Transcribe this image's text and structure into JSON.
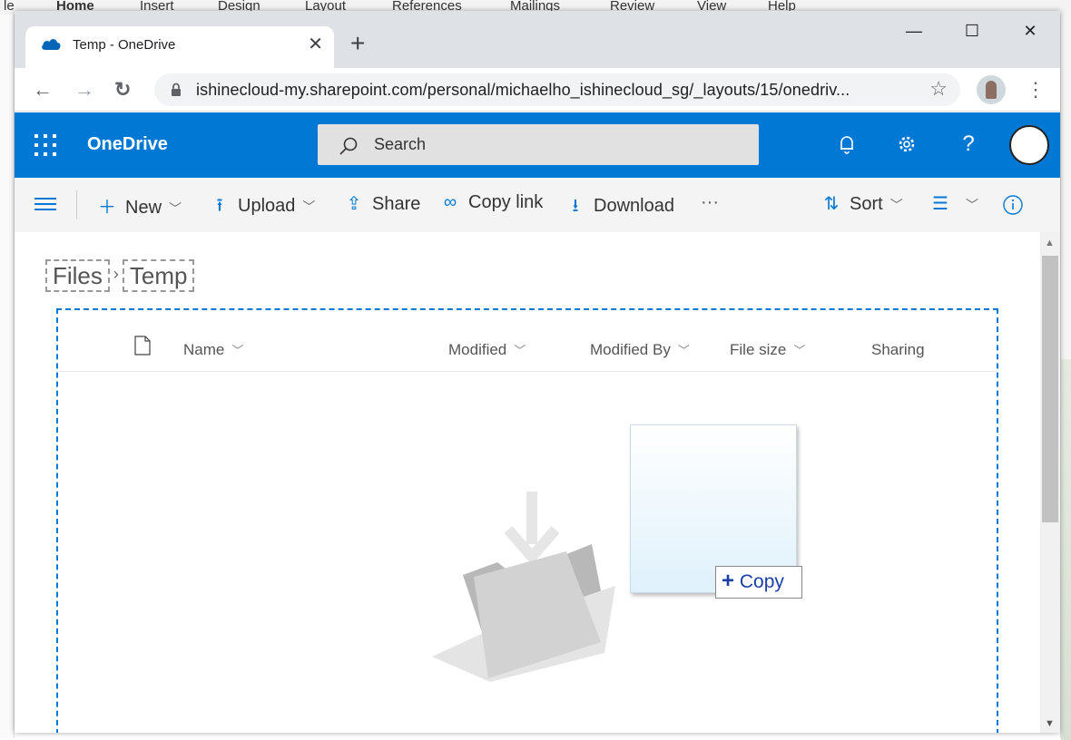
{
  "background_app": {
    "ribbon_tabs": [
      "le",
      "Home",
      "Insert",
      "Design",
      "Layout",
      "References",
      "Mailings",
      "Review",
      "View",
      "Help"
    ]
  },
  "browser": {
    "tab_title": "Temp - OneDrive",
    "tab_close": "✕",
    "new_tab": "+",
    "window_controls": {
      "minimize": "—",
      "maximize": "☐",
      "close": "✕"
    },
    "back": "←",
    "forward": "→",
    "reload": "↻",
    "url": "ishinecloud-my.sharepoint.com/personal/michaelho_ishinecloud_sg/_layouts/15/onedriv...",
    "bookmark": "☆",
    "menu": "⋮"
  },
  "suite": {
    "brand": "OneDrive",
    "search_placeholder": "Search",
    "help": "?"
  },
  "commands": {
    "new": "New",
    "upload": "Upload",
    "share": "Share",
    "copy_link": "Copy link",
    "download": "Download",
    "more": "···",
    "sort": "Sort"
  },
  "breadcrumb": [
    "Files",
    "Temp"
  ],
  "list_columns": [
    "Name",
    "Modified",
    "Modified By",
    "File size",
    "Sharing"
  ],
  "drag": {
    "tooltip_action": "Copy",
    "tooltip_icon": "+"
  },
  "colors": {
    "brand_blue": "#0078d4",
    "command_bar_bg": "#f4f4f4",
    "tab_strip_bg": "#dee1e6"
  }
}
